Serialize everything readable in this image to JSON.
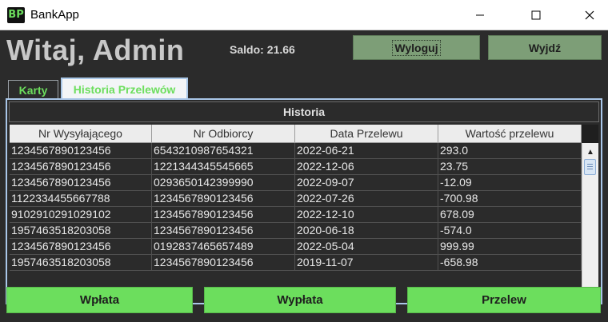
{
  "window": {
    "title": "BankApp",
    "icon_text": "BP"
  },
  "header": {
    "greeting": "Witaj, Admin",
    "balance_label": "Saldo:",
    "balance_value": "21.66",
    "logout_label": "Wyloguj",
    "exit_label": "Wyjdź"
  },
  "tabs": [
    {
      "label": "Karty"
    },
    {
      "label": "Historia Przelewów"
    }
  ],
  "history": {
    "title": "Historia",
    "columns": [
      "Nr Wysyłającego",
      "Nr Odbiorcy",
      "Data Przelewu",
      "Wartość przelewu"
    ],
    "rows": [
      [
        "1234567890123456",
        "6543210987654321",
        "2022-06-21",
        "293.0"
      ],
      [
        "1234567890123456",
        "1221344345545665",
        "2022-12-06",
        "23.75"
      ],
      [
        "1234567890123456",
        "0293650142399990",
        "2022-09-07",
        "-12.09"
      ],
      [
        "1122334455667788",
        "1234567890123456",
        "2022-07-26",
        "-700.98"
      ],
      [
        "9102910291029102",
        "1234567890123456",
        "2022-12-10",
        "678.09"
      ],
      [
        "1957463518203058",
        "1234567890123456",
        "2020-06-18",
        "-574.0"
      ],
      [
        "1234567890123456",
        "0192837465657489",
        "2022-05-04",
        "999.99"
      ],
      [
        "1957463518203058",
        "1234567890123456",
        "2019-11-07",
        "-658.98"
      ]
    ]
  },
  "actions": {
    "deposit_label": "Wpłata",
    "withdraw_label": "Wypłata",
    "transfer_label": "Przelew"
  },
  "colors": {
    "accent_green": "#6cde5d",
    "background": "#2b2b2b",
    "muted_green": "#7d9e77"
  }
}
